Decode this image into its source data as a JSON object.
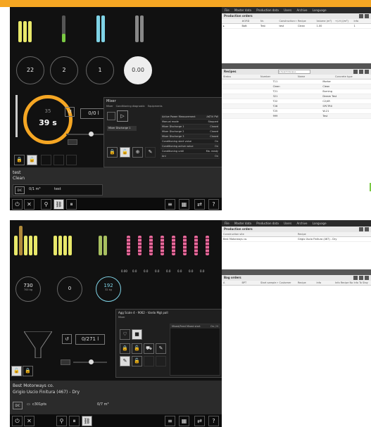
{
  "top": {
    "gauges": [
      "22",
      "2",
      "1",
      "0.00"
    ],
    "timer_small": "35",
    "timer": "39 s",
    "counter": "0/0 l",
    "job_title": "test",
    "job_subtitle": "Clean",
    "qty_badge": "DIC",
    "qty_value": "0/1 m³",
    "qty_name": "test",
    "mixer": {
      "title": "Mixer",
      "tabs": [
        "Mixer",
        "Conditioning diagnostic",
        "Equipments"
      ],
      "select_value": "Mixer Discharge 1",
      "rows": [
        {
          "name": "Active Power Measurement",
          "value": "AKTIV PW"
        },
        {
          "name": "Manual mode",
          "value": "Stopped"
        },
        {
          "name": "Mixer Discharge 1",
          "value": "Closed"
        },
        {
          "name": "Mixer Discharge 2",
          "value": "Closed"
        },
        {
          "name": "Mixer Discharge 3",
          "value": "Closed"
        },
        {
          "name": "Conditioning start value",
          "value": "On"
        },
        {
          "name": "Conditioning active value",
          "value": "On"
        },
        {
          "name": "Conditioning until",
          "value": "Ma. ready"
        },
        {
          "name": "Anl",
          "value": "On"
        }
      ]
    },
    "right": {
      "menu": [
        "File",
        "Master data",
        "Production data",
        "Users",
        "Archive",
        "Language"
      ],
      "production_orders": {
        "title": "Production orders",
        "columns": [
          "",
          "#ORD",
          "Nr.",
          "Construction site",
          "Recipe",
          "Volume (m³)",
          "+/-H (l/m³)",
          "Info"
        ],
        "rows": [
          [
            "▸",
            "Batt",
            "Test",
            "test",
            "Clean",
            "1.00",
            "",
            "1"
          ]
        ]
      },
      "recipes": {
        "title": "Recipes",
        "search_placeholder": "Q Search Recipes",
        "columns": [
          "Status",
          "Number",
          "Name",
          "Concrete type"
        ],
        "rows": [
          [
            "",
            "T11",
            "Mortar"
          ],
          [
            "",
            "Clean",
            "Clean"
          ],
          [
            "",
            "T21",
            "Burning"
          ],
          [
            "",
            "321",
            "Dream Test"
          ],
          [
            "",
            "T22",
            "C2/4R"
          ],
          [
            "",
            "T26",
            "SPCTR0"
          ],
          [
            "",
            "T25",
            "W-21"
          ],
          [
            "",
            "999",
            "Test"
          ]
        ]
      }
    }
  },
  "bottom": {
    "gauges": [
      "730",
      "0",
      "192"
    ],
    "gauge_units": [
      "700 kg",
      "",
      "32 kg"
    ],
    "pink_values": [
      "0.00",
      "0.0",
      "0.0",
      "0.0",
      "0.0",
      "0.0",
      "0.0",
      "0.0"
    ],
    "counter": "0/271 l",
    "agg_title": "Agg Scale 4 - 9062 - Vardo Mgt pall",
    "agg_tab": "Mixer",
    "agg_list_header": "Mixed/Feed Mixed start",
    "agg_list_value": "On / H",
    "customer": "Best Motorways co.",
    "product": "Grigio Uscio Finitura (467) - Dry",
    "qty_badge": "DIC",
    "qty_left": "c301pts",
    "qty_right": "0/7 m³",
    "right": {
      "menu": [
        "File",
        "Master data",
        "Production data",
        "Users",
        "Archive",
        "Language"
      ],
      "production_orders": {
        "title": "Production orders",
        "columns": [
          "Construction site",
          "Recipe"
        ],
        "rows": [
          [
            "Best Motorways co.",
            "Grigio Uscio Finitura (467) - Dry"
          ]
        ]
      },
      "bag_orders": {
        "title": "Bag orders",
        "columns": [
          "A",
          "BPT",
          "Start sample m",
          "Customer",
          "Recipe",
          "Info",
          "Info Recipe No.",
          "Info To Stay"
        ]
      }
    }
  },
  "colors": {
    "accent": "#f5a623",
    "yellow": "#e8e86a",
    "cyan": "#7fd3e6",
    "pink": "#e86a9c",
    "green": "#7ac943"
  }
}
